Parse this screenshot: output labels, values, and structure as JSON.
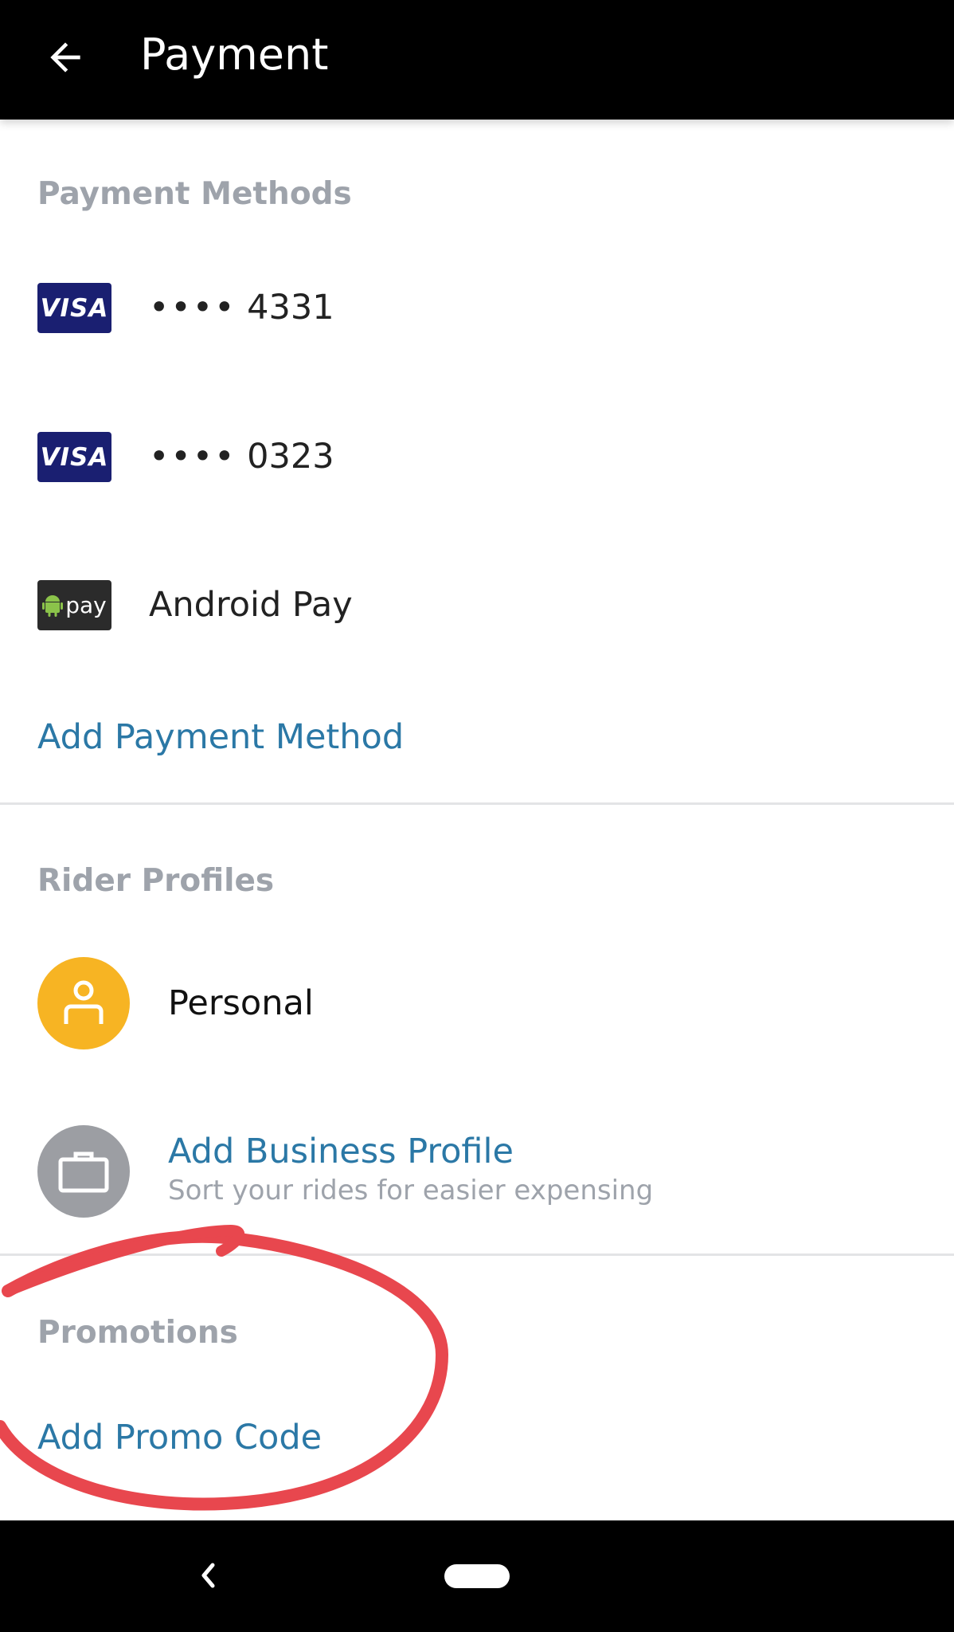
{
  "header": {
    "title": "Payment",
    "back_icon": "arrow-left-icon"
  },
  "payment_methods": {
    "section_title": "Payment Methods",
    "items": [
      {
        "type": "visa",
        "logo_text": "VISA",
        "masked": "••••",
        "last4": "4331"
      },
      {
        "type": "visa",
        "logo_text": "VISA",
        "masked": "••••",
        "last4": "0323"
      },
      {
        "type": "android-pay",
        "logo_text": "pay",
        "label": "Android Pay"
      }
    ],
    "add_label": "Add Payment Method"
  },
  "rider_profiles": {
    "section_title": "Rider Profiles",
    "personal_label": "Personal",
    "business_title": "Add Business Profile",
    "business_subtitle": "Sort your rides for easier expensing"
  },
  "promotions": {
    "section_title": "Promotions",
    "add_label": "Add Promo Code"
  },
  "colors": {
    "accent_link": "#2b78a6",
    "section_gray": "#9ea3ab",
    "personal_avatar": "#f7b423",
    "business_avatar": "#9c9ea3",
    "visa_blue": "#1a1f71",
    "annotation_red": "#e8474e"
  },
  "navbar": {
    "back_icon": "nav-back-icon",
    "home_icon": "nav-home-pill"
  }
}
